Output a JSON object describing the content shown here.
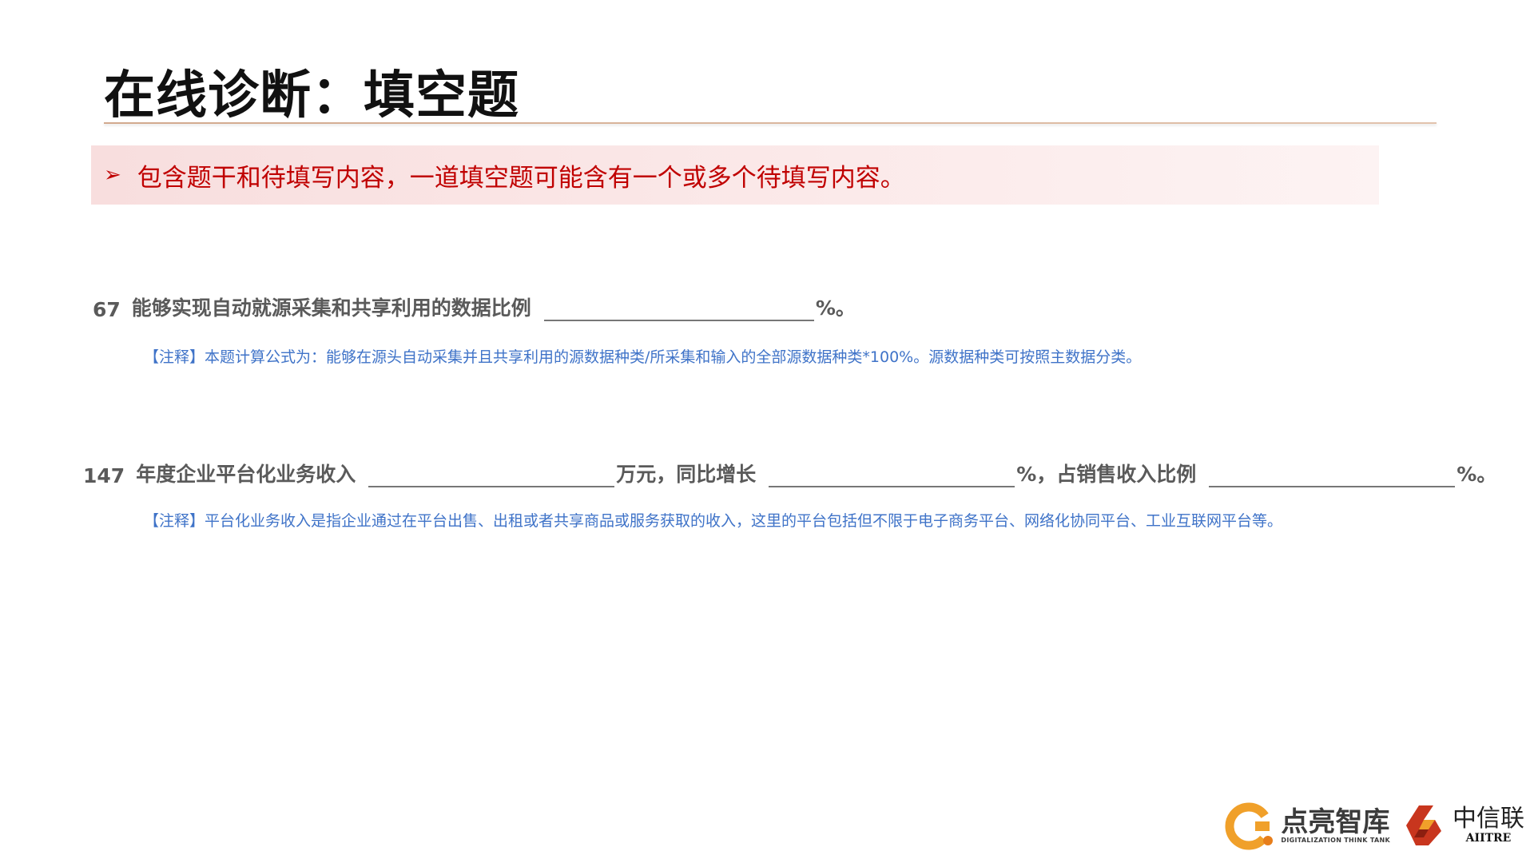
{
  "title": "在线诊断：填空题",
  "banner": {
    "text": "包含题干和待填写内容，一道填空题可能含有一个或多个待填写内容。"
  },
  "questions": [
    {
      "number": "67",
      "stem": "能够实现自动就源采集和共享利用的数据比例",
      "suffix": "%。",
      "note": "【注释】本题计算公式为：能够在源头自动采集并且共享利用的源数据种类/所采集和输入的全部源数据种类*100%。源数据种类可按照主数据分类。"
    },
    {
      "number": "147",
      "stem": "年度企业平台化业务收入",
      "segment2": "万元，同比增长",
      "segment3": "%，占销售收入比例",
      "suffix": "%。",
      "note": "【注释】平台化业务收入是指企业通过在平台出售、出租或者共享商品或服务获取的收入，这里的平台包括但不限于电子商务平台、网络化协同平台、工业互联网平台等。"
    }
  ],
  "logos": {
    "dianliang": {
      "name": "点亮智库",
      "subtitle": "DIGITALIZATION THINK TANK"
    },
    "zhongxinlian": {
      "name": "中信联",
      "subtitle": "AIITRE"
    }
  },
  "colors": {
    "accent_red": "#c00000",
    "note_blue": "#3f73c8",
    "question_gray": "#5a5a5a",
    "logo_orange": "#f0a02a",
    "logo_red": "#c8361e"
  },
  "icons": {
    "bullet": "arrowhead-bullet-icon"
  }
}
